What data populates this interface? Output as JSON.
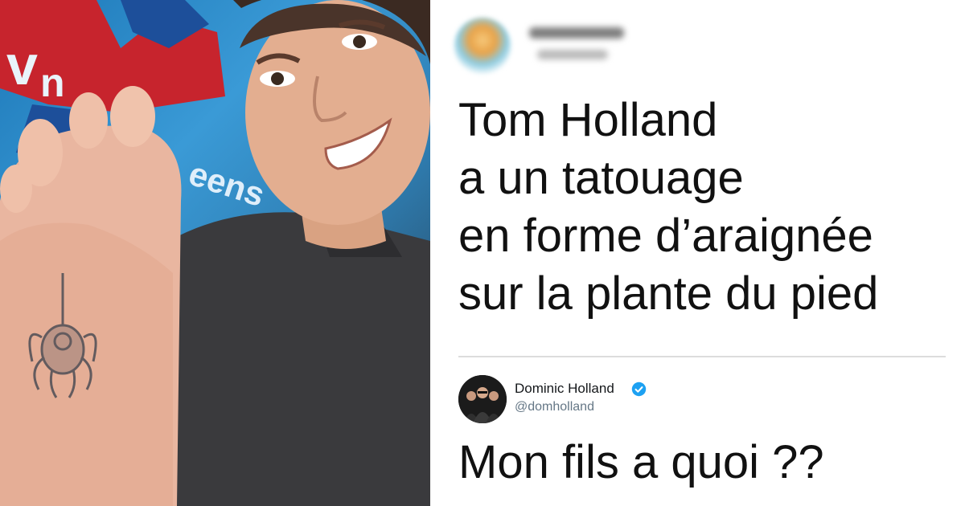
{
  "headline": {
    "lines": [
      "Tom Holland",
      "a un tatouage",
      "en forme d’araignée",
      "sur la plante du pied"
    ]
  },
  "tweet": {
    "author_name": "Dominic Holland",
    "author_handle": "@domholland",
    "text": "Mon fils a quoi ??",
    "verified": true
  },
  "photo": {
    "background_letters": [
      "v",
      "n",
      "eens"
    ]
  },
  "colors": {
    "verified_badge": "#1da1f2",
    "headline_text": "#111111",
    "handle_text": "#657786"
  },
  "icons": [
    "verified-badge-icon",
    "spider-tattoo"
  ]
}
